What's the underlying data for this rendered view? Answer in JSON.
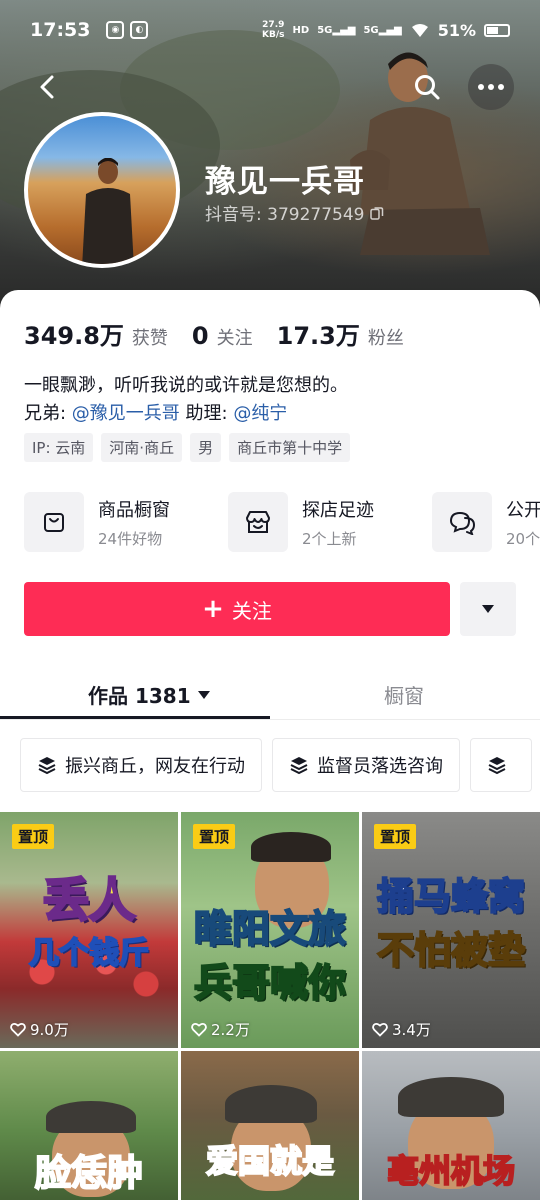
{
  "status_bar": {
    "time": "17:53",
    "net_speed": "27.9",
    "net_unit": "KB/s",
    "hd": "HD",
    "signal1": "5G",
    "signal2": "5G",
    "battery": "51%"
  },
  "profile": {
    "name": "豫见一兵哥",
    "douyin_id": "抖音号: 379277549"
  },
  "stats": [
    {
      "value": "349.8万",
      "label": "获赞"
    },
    {
      "value": "0",
      "label": "关注"
    },
    {
      "value": "17.3万",
      "label": "粉丝"
    }
  ],
  "bio": {
    "line1": "一眼飘渺，听听我说的或许就是您想的。",
    "brother_label": "兄弟: ",
    "brother": "@豫见一兵哥",
    "assistant_label": " 助理: ",
    "assistant": "@纯宁"
  },
  "tags": [
    "IP: 云南",
    "河南·商丘",
    "男",
    "商丘市第十中学"
  ],
  "services": [
    {
      "title": "商品橱窗",
      "sub": "24件好物"
    },
    {
      "title": "探店足迹",
      "sub": "2个上新"
    },
    {
      "title": "公开",
      "sub": "20个"
    }
  ],
  "actions": {
    "follow": "关注"
  },
  "tabs": {
    "works": "作品 1381",
    "shop": "橱窗"
  },
  "collections": [
    "振兴商丘，网友在行动",
    "监督员落选咨询",
    ""
  ],
  "videos": [
    {
      "pinned": "置顶",
      "title1": "丢人",
      "title2": "几个钱斤",
      "likes": "9.0万"
    },
    {
      "pinned": "置顶",
      "title1": "睢阳文旅",
      "title2": "兵哥喊你",
      "likes": "2.2万"
    },
    {
      "pinned": "置顶",
      "title1": "捅马蜂窝",
      "title2": "不怕被垫",
      "likes": "3.4万"
    },
    {
      "title1": "脸恁肿"
    },
    {
      "title1": "爱国就是"
    },
    {
      "title1": "亳州机场"
    }
  ],
  "colors": {
    "accent": "#fe2c55",
    "mention": "#2a5ea8",
    "pin": "#facc15"
  }
}
